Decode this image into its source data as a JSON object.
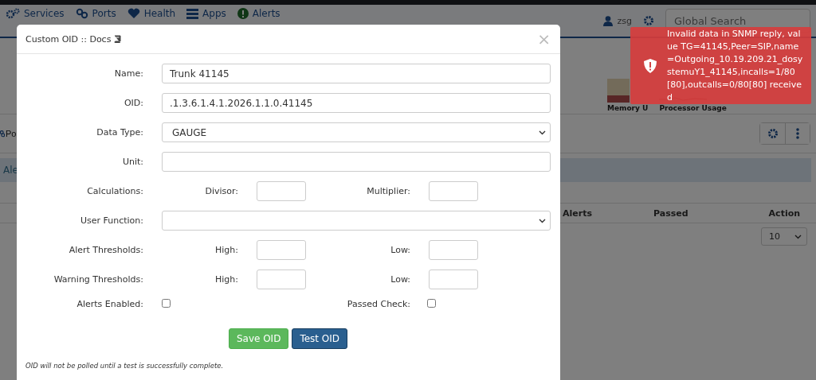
{
  "topnav": {
    "items": [
      {
        "label": "Services"
      },
      {
        "label": "Ports"
      },
      {
        "label": "Health"
      },
      {
        "label": "Apps"
      },
      {
        "label": "Alerts"
      }
    ],
    "user": "zsg",
    "search": {
      "placeholder": "Global Search"
    }
  },
  "background": {
    "graph_labels": [
      "Memory U",
      "Processor Usage"
    ],
    "tab_label": "Po",
    "alert_bar_text": "Ale",
    "table": {
      "columns": [
        "Alerts",
        "Passed",
        "Action"
      ],
      "page_size": "10"
    }
  },
  "modal": {
    "title": "Custom OID :: Docs",
    "close": "×",
    "fields": [
      {
        "kind": "text",
        "label": "Name:",
        "value": "Trunk 41145"
      },
      {
        "kind": "text",
        "label": "OID:",
        "value": ".1.3.6.1.4.1.2026.1.1.0.41145"
      },
      {
        "kind": "select",
        "label": "Data Type:",
        "value": "GAUGE"
      },
      {
        "kind": "text",
        "label": "Unit:"
      },
      {
        "kind": "pair",
        "label": "Calculations:",
        "parts": [
          "Divisor:",
          "Multiplier:"
        ]
      },
      {
        "kind": "select",
        "label": "User Function:"
      },
      {
        "kind": "pair",
        "label": "Alert Thresholds:",
        "parts": [
          "High:",
          "Low:"
        ]
      },
      {
        "kind": "pair",
        "label": "Warning Thresholds:",
        "parts": [
          "High:",
          "Low:"
        ]
      },
      {
        "kind": "checks",
        "label": "Alerts Enabled:",
        "checked": false,
        "second_label": "Passed Check:",
        "second_checked": false
      }
    ],
    "buttons": [
      {
        "label": "Save OID",
        "kind": "success"
      },
      {
        "label": "Test OID",
        "kind": "primary"
      }
    ],
    "note": "OID will not be polled until a test is successfully complete."
  },
  "toast": {
    "message": "Invalid data in SNMP reply, value TG=41145,Peer=SIP,name=Outgoing_10.19.209.21_dosystemuY1_41145,incalls=1/80[80],outcalls=0/80[80] received"
  }
}
